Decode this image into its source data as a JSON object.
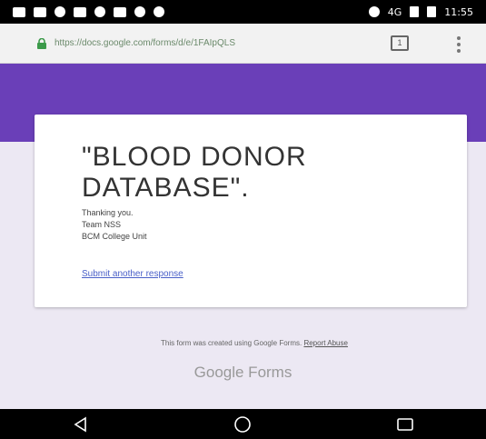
{
  "status_bar": {
    "network": "4G",
    "time": "11:55"
  },
  "address_bar": {
    "url": "https://docs.google.com/forms/d/e/1FAIpQLS",
    "tab_count": "1"
  },
  "form": {
    "title": "\"BLOOD DONOR DATABASE\".",
    "message_lines": [
      "Thanking you.",
      "Team NSS",
      "BCM College Unit"
    ],
    "submit_another_label": "Submit another response"
  },
  "footer": {
    "note_text": "This form was created using Google Forms.",
    "report_label": "Report Abuse",
    "logo_text": "Google Forms"
  },
  "colors": {
    "accent": "#6a3fb8",
    "link": "#4a60c8",
    "background": "#ece8f3"
  },
  "nav": {
    "back_icon": "back-icon",
    "home_icon": "home-icon",
    "recents_icon": "recents-icon"
  }
}
